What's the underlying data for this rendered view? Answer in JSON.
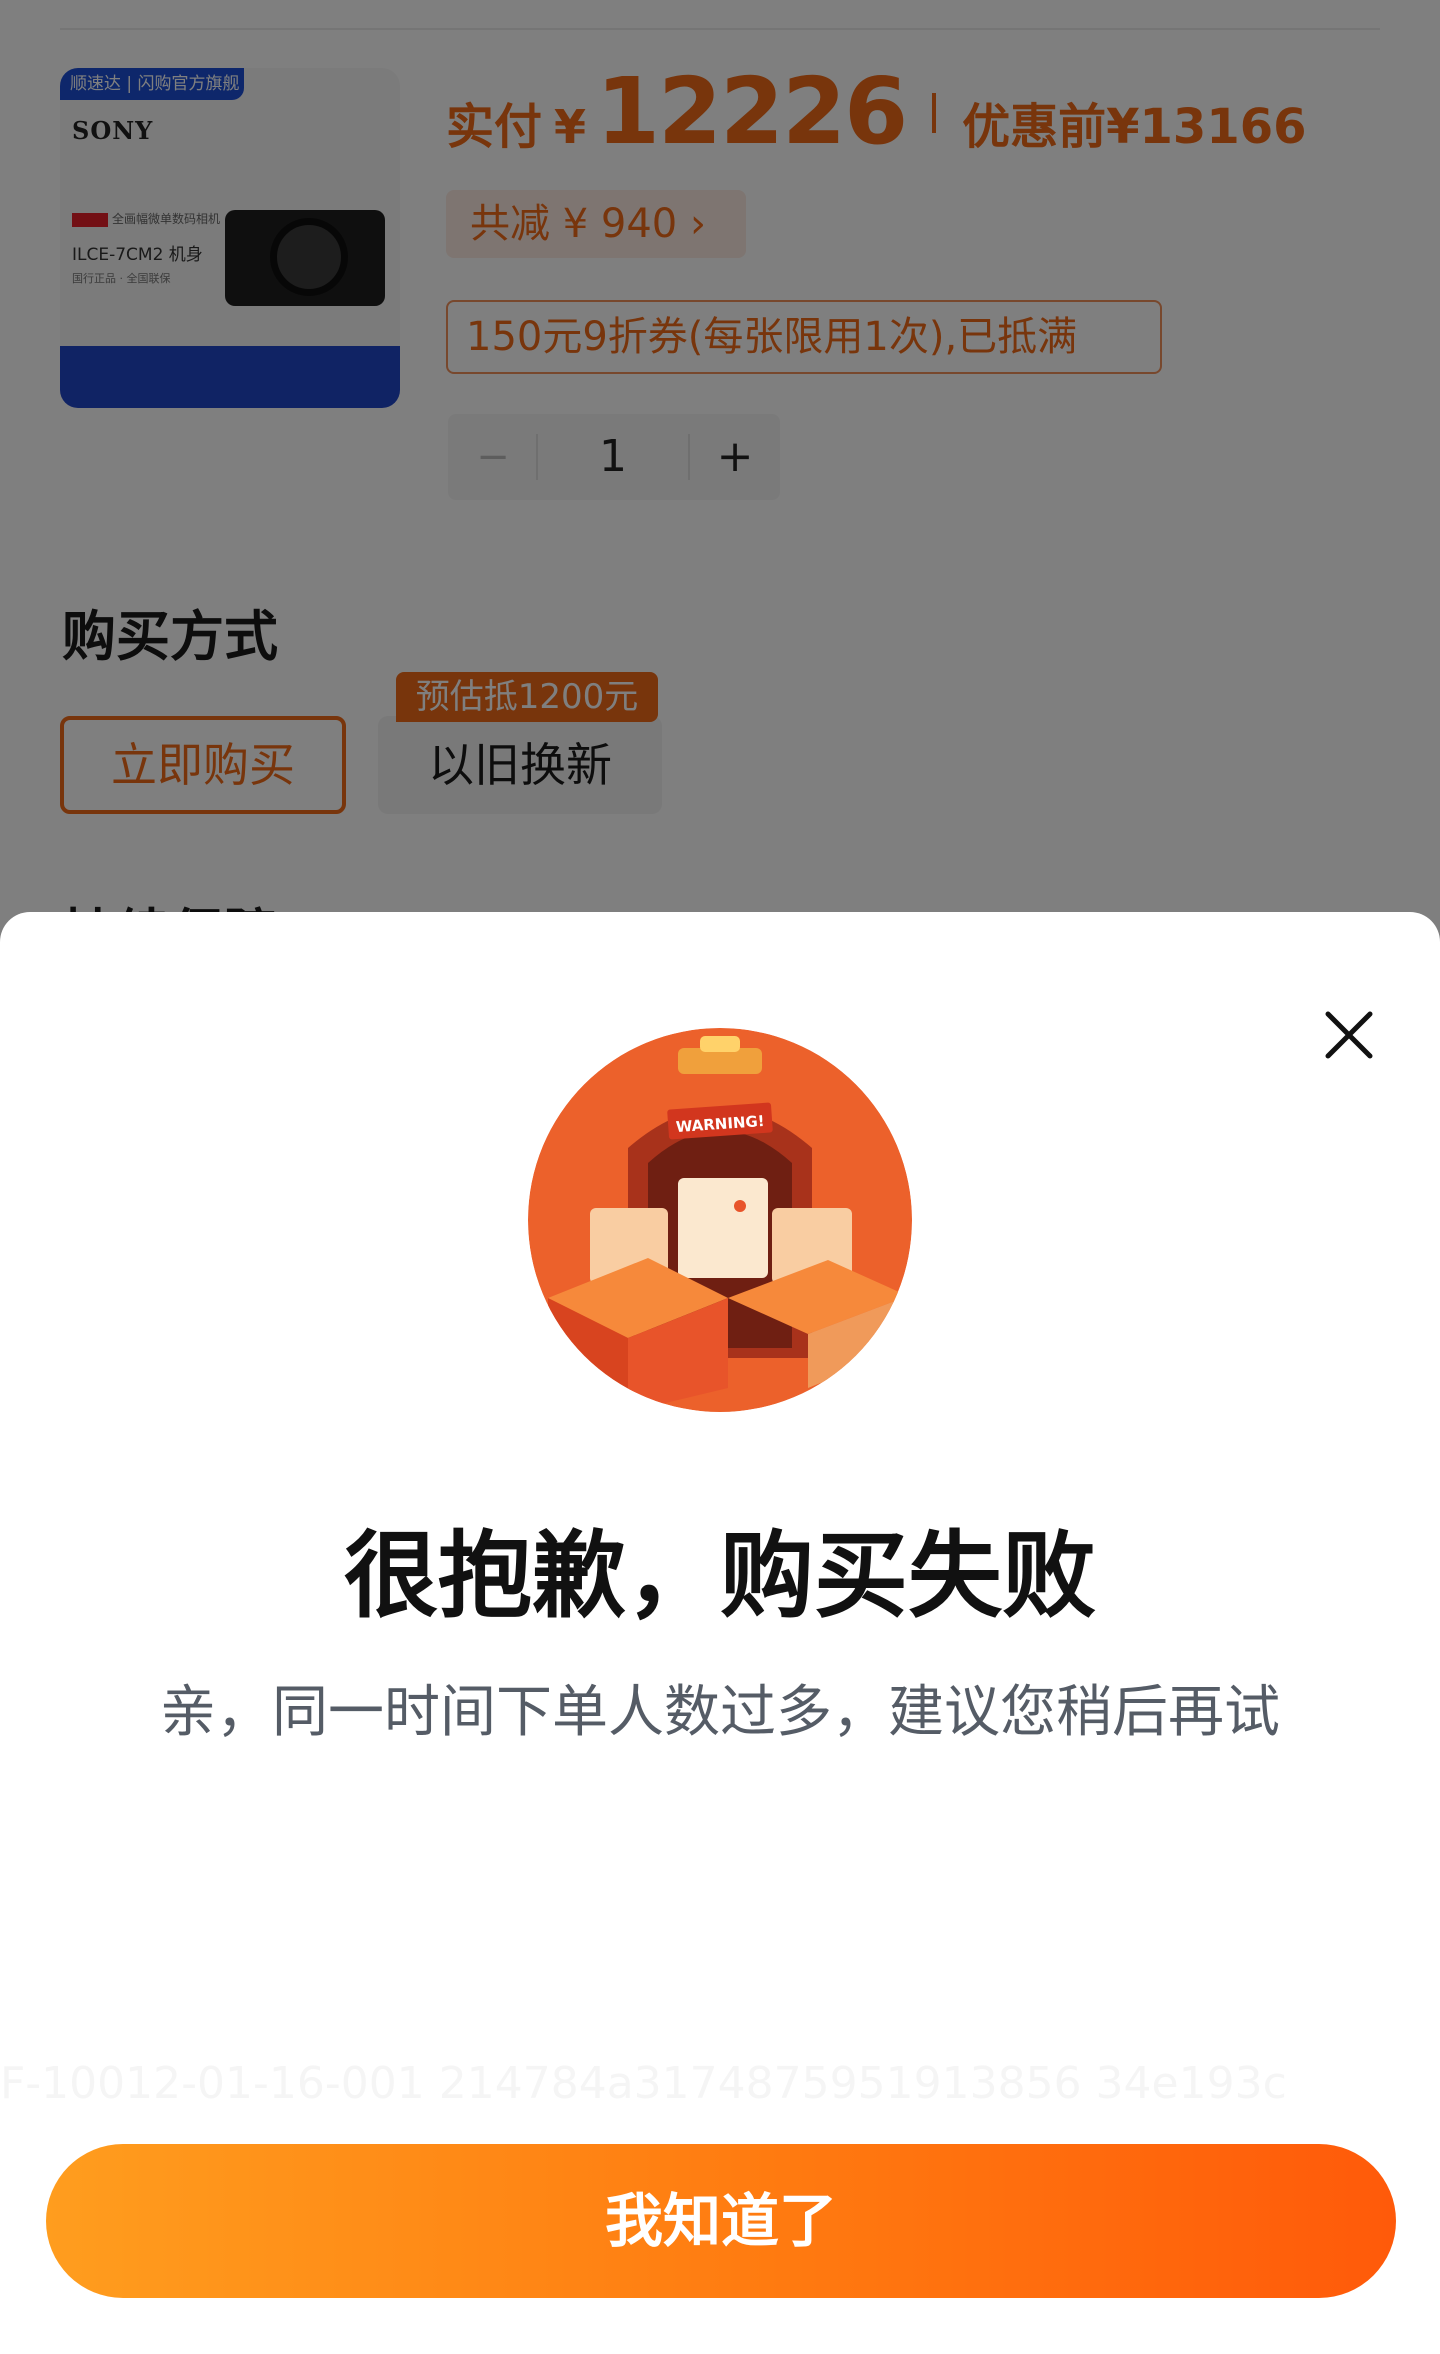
{
  "product": {
    "image_top_label": "顺速达 | 闪购官方旗舰",
    "brand": "SONY",
    "image_subtitle": "全画幅微单数码相机",
    "model": "ILCE-7CM2 机身",
    "image_features": "国行正品 · 全国联保"
  },
  "price": {
    "paid_label": "实付",
    "currency": "¥",
    "paid_amount": "12226",
    "original_label": "优惠前",
    "original_price": "¥13166",
    "discount_text": "共减 ¥ 940 ›",
    "coupon_text": "150元9折券(每张限用1次),已抵满"
  },
  "quantity": {
    "minus": "−",
    "value": "1",
    "plus": "+"
  },
  "purchase": {
    "title": "购买方式",
    "option_buy_now": "立即购买",
    "option_trade_in": "以旧换新",
    "trade_in_badge": "预估抵1200元",
    "next_section_title": "持续保障"
  },
  "dialog": {
    "illustration_text": "WARNING!",
    "title": "很抱歉，购买失败",
    "message": "亲，同一时间下单人数过多，建议您稍后再试",
    "trace_id": "F-10012-01-16-001 214784a3174875951913856 34e193c",
    "confirm_label": "我知道了"
  },
  "colors": {
    "accent": "#f06a18",
    "button_gradient_start": "#ff9d1e",
    "button_gradient_end": "#ff5a0a",
    "illustration_red": "#e8542a"
  }
}
